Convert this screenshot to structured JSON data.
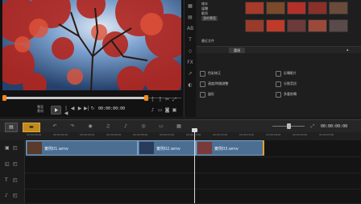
{
  "player": {
    "project_label": "專案",
    "clip_label": "素材",
    "timecode": "00:00:00:00"
  },
  "library": {
    "folders": [
      "樣本",
      "媒體",
      "範例",
      "我的專案",
      "最近文件"
    ],
    "tab_label": "選項",
    "options": [
      "色彩修正",
      "速度/時間調整",
      "變形",
      "反轉影片",
      "分割音訊",
      "多重剪輯"
    ]
  },
  "timeline": {
    "ruler_ticks": [
      "00:00:00:00",
      "00:00:02:00",
      "00:00:04:00",
      "00:00:06:00",
      "00:00:08:00",
      "00:00:10:00",
      "00:00:12:00",
      "00:00:14:00",
      "00:00:16:00",
      "00:00:18:00",
      "00:00:20:00",
      "00:00:22:00"
    ],
    "clips": [
      {
        "label": "實例01.wmv"
      },
      {
        "label": "實例02.wmv"
      },
      {
        "label": "實例03.wmv"
      }
    ]
  },
  "colors": {
    "accent": "#f08a1c",
    "clip": "#4b6f93",
    "clip_border": "#7aa0c4"
  }
}
